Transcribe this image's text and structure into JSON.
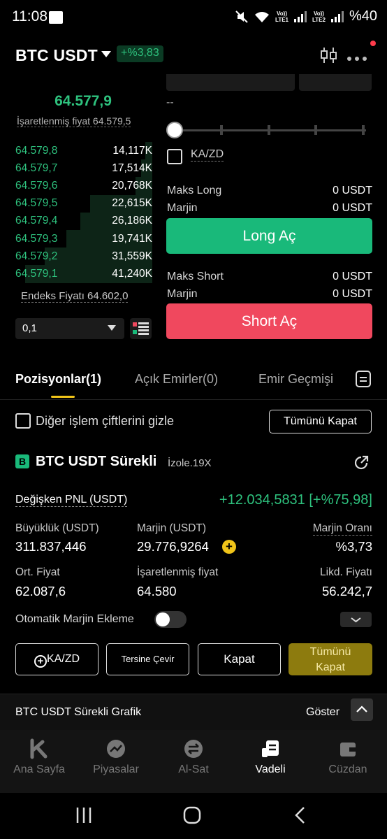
{
  "status_bar": {
    "time": "11:08",
    "battery": "%40",
    "sim1": "LTE1",
    "sim2": "LTE2",
    "volte": "Vo))"
  },
  "header": {
    "pair": "BTC USDT",
    "change": "+%3,83"
  },
  "order_book": {
    "last_price": "64.577,9",
    "mark_price": "İşaretlenmiş fiyat 64.579,5",
    "rows": [
      {
        "price": "64.579,8",
        "qty": "14,117K",
        "depth": 0.05
      },
      {
        "price": "64.579,7",
        "qty": "17,514K",
        "depth": 0.08
      },
      {
        "price": "64.579,6",
        "qty": "20,768K",
        "depth": 0.12
      },
      {
        "price": "64.579,5",
        "qty": "22,615K",
        "depth": 0.45
      },
      {
        "price": "64.579,4",
        "qty": "26,186K",
        "depth": 0.52
      },
      {
        "price": "64.579,3",
        "qty": "19,741K",
        "depth": 0.62
      },
      {
        "price": "64.579,2",
        "qty": "31,559K",
        "depth": 0.78
      },
      {
        "price": "64.579,1",
        "qty": "41,240K",
        "depth": 0.92
      }
    ],
    "index_price": "Endeks Fiyatı 64.602,0",
    "precision": "0,1"
  },
  "trade_panel": {
    "size_placeholder": "--",
    "tpsl_label": "KA/ZD",
    "max_long_label": "Maks Long",
    "max_long_value": "0 USDT",
    "margin_label_1": "Marjin",
    "margin_value_1": "0 USDT",
    "long_button": "Long Aç",
    "max_short_label": "Maks Short",
    "max_short_value": "0 USDT",
    "margin_label_2": "Marjin",
    "margin_value_2": "0 USDT",
    "short_button": "Short Aç"
  },
  "tabs": {
    "positions": "Pozisyonlar(1)",
    "open_orders": "Açık Emirler(0)",
    "order_history": "Emir Geçmişi"
  },
  "filter": {
    "hide_other_pairs": "Diğer işlem çiftlerini gizle",
    "close_all": "Tümünü Kapat"
  },
  "position": {
    "side_badge": "B",
    "title": "BTC USDT Sürekli",
    "mode": "İzole.19X",
    "pnl_label": "Değişken PNL (USDT)",
    "pnl_value": "+12.034,5831 [+%75,98]",
    "size_label": "Büyüklük (USDT)",
    "size_value": "311.837,446",
    "margin_label": "Marjin (USDT)",
    "margin_value": "29.776,9264",
    "margin_ratio_label": "Marjin Oranı",
    "margin_ratio_value": "%3,73",
    "entry_label": "Ort. Fiyat",
    "entry_value": "62.087,6",
    "mark_label": "İşaretlenmiş fiyat",
    "mark_value": "64.580",
    "liq_label": "Likd. Fiyatı",
    "liq_value": "56.242,7",
    "auto_margin_label": "Otomatik Marjin Ekleme",
    "buttons": {
      "tpsl": "KA/ZD",
      "reverse": "Tersine Çevir",
      "close": "Kapat",
      "close_all_1": "Tümünü",
      "close_all_2": "Kapat"
    }
  },
  "chart_strip": {
    "label": "BTC USDT Sürekli Grafik",
    "show": "Göster"
  },
  "bottom_nav": [
    {
      "label": "Ana Sayfa",
      "active": false
    },
    {
      "label": "Piyasalar",
      "active": false
    },
    {
      "label": "Al-Sat",
      "active": false
    },
    {
      "label": "Vadeli",
      "active": true
    },
    {
      "label": "Cüzdan",
      "active": false
    }
  ],
  "colors": {
    "green": "#2ec27e",
    "long": "#19b97a",
    "short": "#f0485e",
    "accent": "#f0c419"
  }
}
